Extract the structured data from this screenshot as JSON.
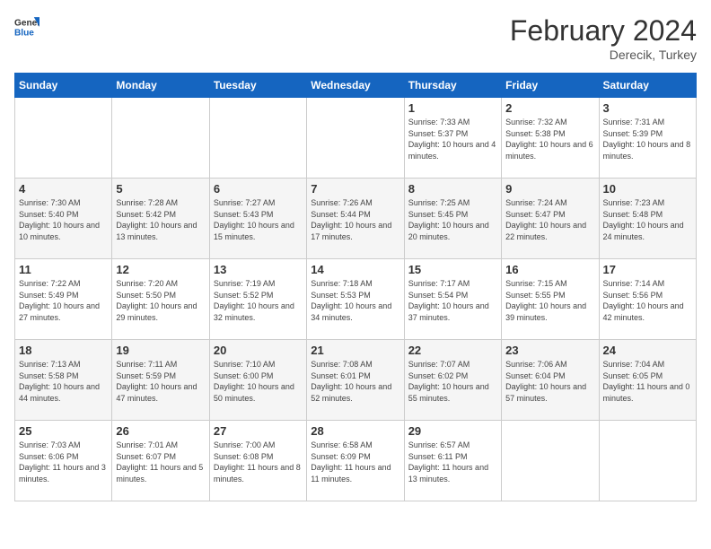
{
  "header": {
    "logo_general": "General",
    "logo_blue": "Blue",
    "title": "February 2024",
    "subtitle": "Derecik, Turkey"
  },
  "days_of_week": [
    "Sunday",
    "Monday",
    "Tuesday",
    "Wednesday",
    "Thursday",
    "Friday",
    "Saturday"
  ],
  "weeks": [
    [
      {
        "day": "",
        "sunrise": "",
        "sunset": "",
        "daylight": "",
        "empty": true
      },
      {
        "day": "",
        "sunrise": "",
        "sunset": "",
        "daylight": "",
        "empty": true
      },
      {
        "day": "",
        "sunrise": "",
        "sunset": "",
        "daylight": "",
        "empty": true
      },
      {
        "day": "",
        "sunrise": "",
        "sunset": "",
        "daylight": "",
        "empty": true
      },
      {
        "day": "1",
        "sunrise": "Sunrise: 7:33 AM",
        "sunset": "Sunset: 5:37 PM",
        "daylight": "Daylight: 10 hours and 4 minutes."
      },
      {
        "day": "2",
        "sunrise": "Sunrise: 7:32 AM",
        "sunset": "Sunset: 5:38 PM",
        "daylight": "Daylight: 10 hours and 6 minutes."
      },
      {
        "day": "3",
        "sunrise": "Sunrise: 7:31 AM",
        "sunset": "Sunset: 5:39 PM",
        "daylight": "Daylight: 10 hours and 8 minutes."
      }
    ],
    [
      {
        "day": "4",
        "sunrise": "Sunrise: 7:30 AM",
        "sunset": "Sunset: 5:40 PM",
        "daylight": "Daylight: 10 hours and 10 minutes."
      },
      {
        "day": "5",
        "sunrise": "Sunrise: 7:28 AM",
        "sunset": "Sunset: 5:42 PM",
        "daylight": "Daylight: 10 hours and 13 minutes."
      },
      {
        "day": "6",
        "sunrise": "Sunrise: 7:27 AM",
        "sunset": "Sunset: 5:43 PM",
        "daylight": "Daylight: 10 hours and 15 minutes."
      },
      {
        "day": "7",
        "sunrise": "Sunrise: 7:26 AM",
        "sunset": "Sunset: 5:44 PM",
        "daylight": "Daylight: 10 hours and 17 minutes."
      },
      {
        "day": "8",
        "sunrise": "Sunrise: 7:25 AM",
        "sunset": "Sunset: 5:45 PM",
        "daylight": "Daylight: 10 hours and 20 minutes."
      },
      {
        "day": "9",
        "sunrise": "Sunrise: 7:24 AM",
        "sunset": "Sunset: 5:47 PM",
        "daylight": "Daylight: 10 hours and 22 minutes."
      },
      {
        "day": "10",
        "sunrise": "Sunrise: 7:23 AM",
        "sunset": "Sunset: 5:48 PM",
        "daylight": "Daylight: 10 hours and 24 minutes."
      }
    ],
    [
      {
        "day": "11",
        "sunrise": "Sunrise: 7:22 AM",
        "sunset": "Sunset: 5:49 PM",
        "daylight": "Daylight: 10 hours and 27 minutes."
      },
      {
        "day": "12",
        "sunrise": "Sunrise: 7:20 AM",
        "sunset": "Sunset: 5:50 PM",
        "daylight": "Daylight: 10 hours and 29 minutes."
      },
      {
        "day": "13",
        "sunrise": "Sunrise: 7:19 AM",
        "sunset": "Sunset: 5:52 PM",
        "daylight": "Daylight: 10 hours and 32 minutes."
      },
      {
        "day": "14",
        "sunrise": "Sunrise: 7:18 AM",
        "sunset": "Sunset: 5:53 PM",
        "daylight": "Daylight: 10 hours and 34 minutes."
      },
      {
        "day": "15",
        "sunrise": "Sunrise: 7:17 AM",
        "sunset": "Sunset: 5:54 PM",
        "daylight": "Daylight: 10 hours and 37 minutes."
      },
      {
        "day": "16",
        "sunrise": "Sunrise: 7:15 AM",
        "sunset": "Sunset: 5:55 PM",
        "daylight": "Daylight: 10 hours and 39 minutes."
      },
      {
        "day": "17",
        "sunrise": "Sunrise: 7:14 AM",
        "sunset": "Sunset: 5:56 PM",
        "daylight": "Daylight: 10 hours and 42 minutes."
      }
    ],
    [
      {
        "day": "18",
        "sunrise": "Sunrise: 7:13 AM",
        "sunset": "Sunset: 5:58 PM",
        "daylight": "Daylight: 10 hours and 44 minutes."
      },
      {
        "day": "19",
        "sunrise": "Sunrise: 7:11 AM",
        "sunset": "Sunset: 5:59 PM",
        "daylight": "Daylight: 10 hours and 47 minutes."
      },
      {
        "day": "20",
        "sunrise": "Sunrise: 7:10 AM",
        "sunset": "Sunset: 6:00 PM",
        "daylight": "Daylight: 10 hours and 50 minutes."
      },
      {
        "day": "21",
        "sunrise": "Sunrise: 7:08 AM",
        "sunset": "Sunset: 6:01 PM",
        "daylight": "Daylight: 10 hours and 52 minutes."
      },
      {
        "day": "22",
        "sunrise": "Sunrise: 7:07 AM",
        "sunset": "Sunset: 6:02 PM",
        "daylight": "Daylight: 10 hours and 55 minutes."
      },
      {
        "day": "23",
        "sunrise": "Sunrise: 7:06 AM",
        "sunset": "Sunset: 6:04 PM",
        "daylight": "Daylight: 10 hours and 57 minutes."
      },
      {
        "day": "24",
        "sunrise": "Sunrise: 7:04 AM",
        "sunset": "Sunset: 6:05 PM",
        "daylight": "Daylight: 11 hours and 0 minutes."
      }
    ],
    [
      {
        "day": "25",
        "sunrise": "Sunrise: 7:03 AM",
        "sunset": "Sunset: 6:06 PM",
        "daylight": "Daylight: 11 hours and 3 minutes."
      },
      {
        "day": "26",
        "sunrise": "Sunrise: 7:01 AM",
        "sunset": "Sunset: 6:07 PM",
        "daylight": "Daylight: 11 hours and 5 minutes."
      },
      {
        "day": "27",
        "sunrise": "Sunrise: 7:00 AM",
        "sunset": "Sunset: 6:08 PM",
        "daylight": "Daylight: 11 hours and 8 minutes."
      },
      {
        "day": "28",
        "sunrise": "Sunrise: 6:58 AM",
        "sunset": "Sunset: 6:09 PM",
        "daylight": "Daylight: 11 hours and 11 minutes."
      },
      {
        "day": "29",
        "sunrise": "Sunrise: 6:57 AM",
        "sunset": "Sunset: 6:11 PM",
        "daylight": "Daylight: 11 hours and 13 minutes."
      },
      {
        "day": "",
        "sunrise": "",
        "sunset": "",
        "daylight": "",
        "empty": true
      },
      {
        "day": "",
        "sunrise": "",
        "sunset": "",
        "daylight": "",
        "empty": true
      }
    ]
  ]
}
